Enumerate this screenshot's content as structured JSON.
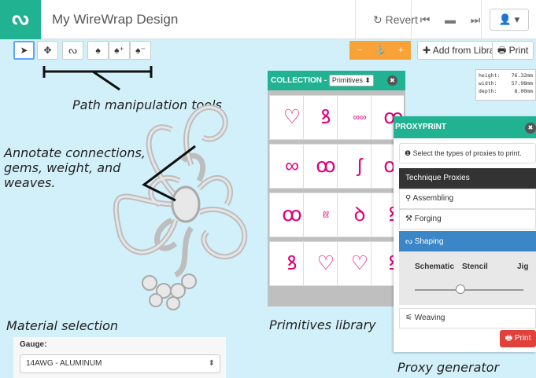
{
  "header": {
    "logo": "ᔓ",
    "title": "My WireWrap Design",
    "revert": "↻ Revert",
    "nav": [
      "⏮",
      "▬",
      "⏭"
    ],
    "user": "👤 ▾"
  },
  "toolbar": {
    "tools": [
      {
        "name": "select-tool",
        "icon": "➤"
      },
      {
        "name": "move-tool",
        "icon": "✥"
      },
      {
        "name": "path-tool",
        "icon": "ᔓ"
      },
      {
        "name": "pen-tool",
        "icon": "♠"
      },
      {
        "name": "pen-add-tool",
        "icon": "♠⁺"
      },
      {
        "name": "pen-remove-tool",
        "icon": "♠⁻"
      }
    ],
    "zoom_out": "−",
    "anchor": "⚓",
    "zoom_in": "+",
    "add_from_library": "✚ Add from Library",
    "print": "🖶 Print"
  },
  "annotations": {
    "path_tools": "Path manipulation tools",
    "connections": [
      "Annotate connections,",
      "gems, weight, and",
      "weaves."
    ],
    "material": "Material selection",
    "primitives": "Primitives library",
    "proxy": "Proxy generator"
  },
  "collection": {
    "label": "COLLECTION -",
    "selected": "Primitives ⬍",
    "close": "✖",
    "tiles": [
      "♡",
      "ꝸ",
      "∞∞",
      "ꝏ",
      "∞",
      "ꝏ",
      "ʃ",
      "ꝏ",
      "ꝏ",
      "ℓℓ",
      "ꝺ",
      "ꝸ",
      "ꝸ",
      "♡",
      "♡",
      "ꝸ"
    ]
  },
  "proxyprint": {
    "title": "PROXYPRINT",
    "close": "✖",
    "info": "❶ Select the types of proxies to print.",
    "section": "Technique Proxies",
    "items": [
      "⚲ Assembling",
      "⚒ Forging",
      "ᔓ Shaping"
    ],
    "options": [
      "Schematic",
      "Stencil",
      "Jig"
    ],
    "slider_value": 0.42,
    "weaving": "⚟ Weaving",
    "print": "🖶 Print"
  },
  "dimensions": [
    {
      "label": "height:",
      "value": "76.32mm"
    },
    {
      "label": "width:",
      "value": "57.98mm"
    },
    {
      "label": "depth:",
      "value": "8.00mm"
    }
  ],
  "gauge": {
    "label": "Gauge:",
    "value": "14AWG - ALUMINUM",
    "arrow": "⬍"
  }
}
